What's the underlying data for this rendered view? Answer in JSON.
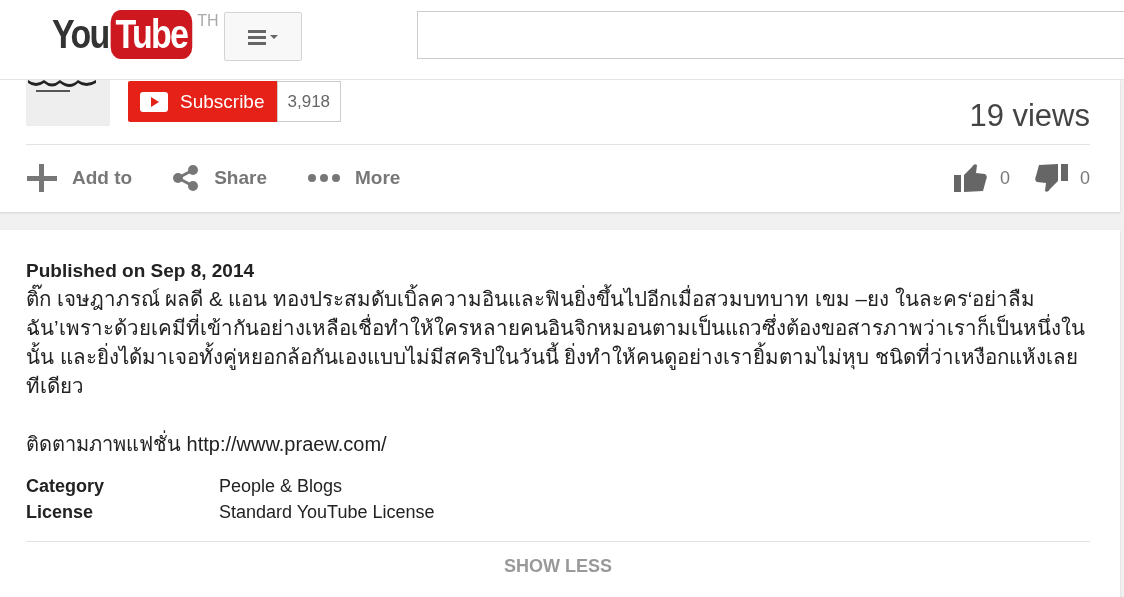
{
  "header": {
    "logo": {
      "left": "You",
      "right": "Tube"
    },
    "region": "TH"
  },
  "channel": {
    "subscribe": "Subscribe",
    "subscriber_count": "3,918",
    "views": "19 views"
  },
  "actions": [
    {
      "kind": "add",
      "label": "Add to"
    },
    {
      "kind": "share",
      "label": "Share"
    },
    {
      "kind": "more",
      "label": "More"
    }
  ],
  "ratings": [
    {
      "kind": "like",
      "count": "0"
    },
    {
      "kind": "dislike",
      "count": "0"
    }
  ],
  "description": {
    "published": "Published on Sep 8, 2014",
    "text": "ติ๊ก เจษฎาภรณ์ ผลดี & แอน ทองประสมดับเบิ้ลความอินและฟินยิ่งขึ้นไปอีกเมื่อสวมบทบาท เขม –ยง ในละคร‘อย่าลืมฉัน’เพราะด้วยเคมีที่เข้ากันอย่างเหลือเชื่อทำให้ใครหลายคนอินจิกหมอนตามเป็นแถวซึ่งต้องขอสารภาพว่าเราก็เป็นหนึ่งในนั้น และยิ่งได้มาเจอทั้งคู่หยอกล้อกันเองแบบไม่มีสคริปในวันนี้ ยิ่งทำให้คนดูอย่างเรายิ้มตามไม่หุบ ชนิดที่ว่าเหงือกแห้งเลยทีเดียว",
    "follow": "ติดตามภาพแฟชั่น http://www.praew.com/",
    "meta": [
      {
        "label": "Category",
        "value": "People & Blogs"
      },
      {
        "label": "License",
        "value": "Standard YouTube License"
      }
    ],
    "toggle": "SHOW LESS"
  }
}
